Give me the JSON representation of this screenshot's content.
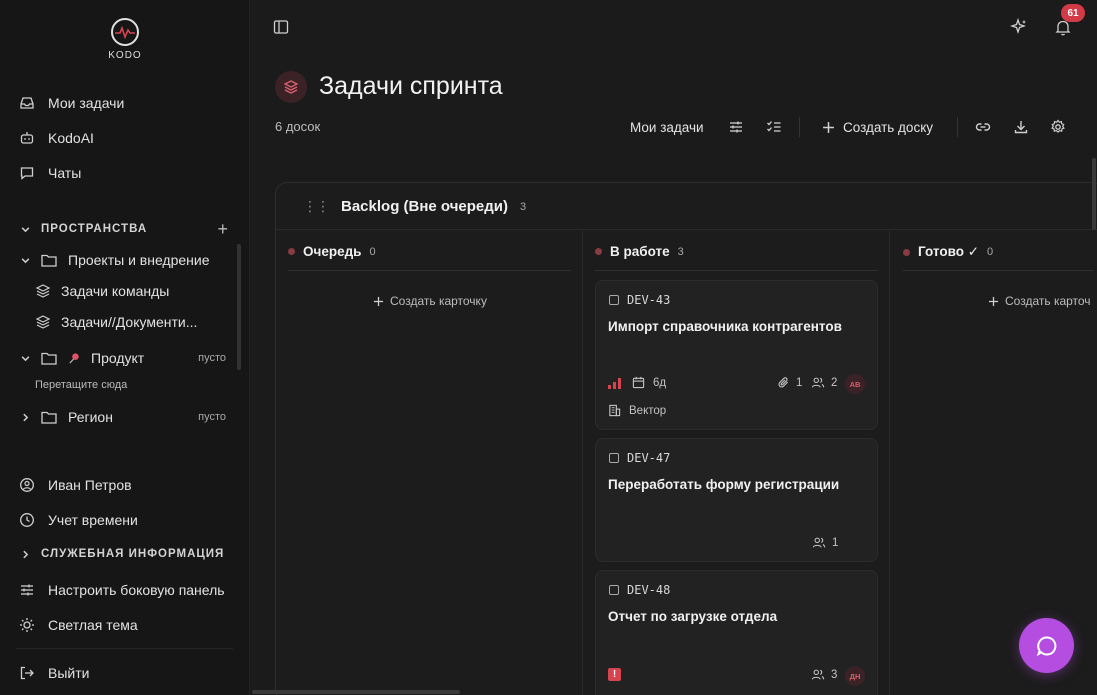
{
  "app": {
    "logo_text": "KODO",
    "brand_color": "#d5444f",
    "fab_color": "#b44de0"
  },
  "sidebar": {
    "top_items": [
      {
        "label": "Мои задачи",
        "icon": "inbox-icon"
      },
      {
        "label": "KodoAI",
        "icon": "robot-icon"
      },
      {
        "label": "Чаты",
        "icon": "chat-icon"
      }
    ],
    "spaces": {
      "title": "ПРОСТРАНСТВА",
      "items": [
        {
          "label": "Проекты и внедрение"
        },
        {
          "label": "Задачи команды"
        },
        {
          "label": "Задачи//Документи..."
        },
        {
          "label": "Продукт",
          "trailing": "пусто"
        },
        {
          "label": "Регион",
          "trailing": "пусто"
        }
      ],
      "drop_hint": "Перетащите сюда"
    },
    "bottom_items": [
      {
        "label": "Иван Петров"
      },
      {
        "label": "Учет времени"
      }
    ],
    "service_section": "СЛУЖЕБНАЯ ИНФОРМАЦИЯ",
    "settings_items": [
      {
        "label": "Настроить боковую панель"
      },
      {
        "label": "Светлая тема"
      },
      {
        "label": "Выйти"
      }
    ]
  },
  "header": {
    "notifications_count": "61"
  },
  "page": {
    "title": "Задачи спринта",
    "subtitle": "6 досок",
    "toolbar": {
      "my_tasks": "Мои задачи",
      "create_board": "Создать доску"
    }
  },
  "board": {
    "title": "Backlog (Вне очереди)",
    "count": "3",
    "columns": [
      {
        "title": "Очередь",
        "count": "0",
        "create_label": "Создать карточку"
      },
      {
        "title": "В работе",
        "count": "3"
      },
      {
        "title": "Готово ✓",
        "count": "0",
        "create_label": "Создать карточ"
      }
    ],
    "cards": [
      {
        "id": "DEV-43",
        "title": "Импорт справочника контрагентов",
        "due": "6д",
        "attachments": "1",
        "assignees": "2",
        "avatar": "АВ",
        "tag": "Вектор"
      },
      {
        "id": "DEV-47",
        "title": "Переработать форму регистрации",
        "assignees": "1"
      },
      {
        "id": "DEV-48",
        "title": "Отчет по загрузке отдела",
        "assignees": "3",
        "avatar": "ДН"
      }
    ]
  }
}
